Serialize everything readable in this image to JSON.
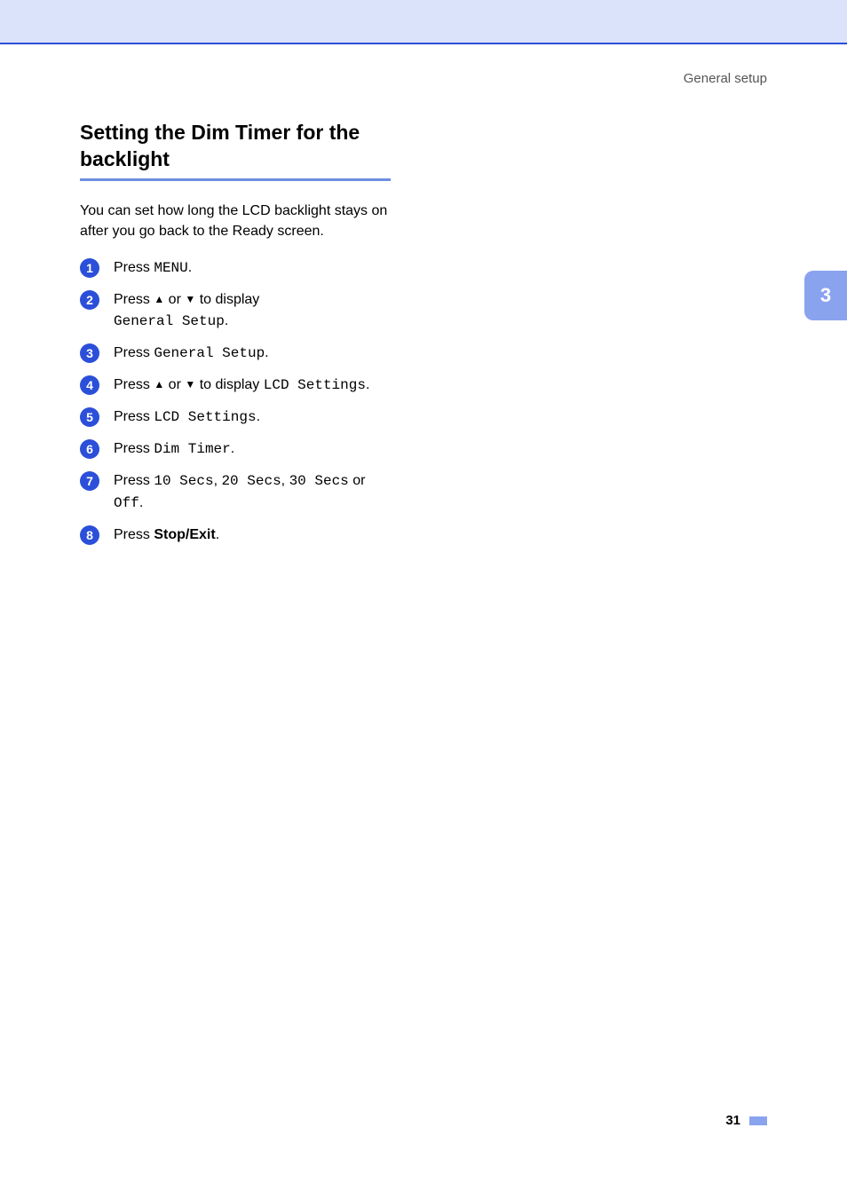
{
  "header": {
    "breadcrumb": "General setup"
  },
  "title": "Setting the Dim Timer for the backlight",
  "intro": "You can set how long the LCD backlight stays on after you go back to the Ready screen.",
  "steps": [
    {
      "num": "1",
      "prefix": "Press ",
      "mono1": "MENU",
      "mid": "",
      "mono2": "",
      "suffix": "."
    },
    {
      "num": "2",
      "prefix": "Press ",
      "up": "▲",
      "conj": " or ",
      "down": "▼",
      "mid": " to display ",
      "mono1": "General Setup",
      "suffix": ".",
      "breakBeforeMono": true
    },
    {
      "num": "3",
      "prefix": "Press ",
      "mono1": "General Setup",
      "suffix": "."
    },
    {
      "num": "4",
      "prefix": "Press ",
      "up": "▲",
      "conj": " or ",
      "down": "▼",
      "mid": " to display ",
      "mono1": "LCD Settings",
      "suffix": "."
    },
    {
      "num": "5",
      "prefix": "Press ",
      "mono1": "LCD Settings",
      "suffix": "."
    },
    {
      "num": "6",
      "prefix": "Press ",
      "mono1": "Dim Timer",
      "suffix": "."
    },
    {
      "num": "7",
      "prefix": "Press ",
      "mono1": "10 Secs",
      "sep1": ", ",
      "mono2": "20 Secs",
      "sep2": ", ",
      "mono3": "30 Secs",
      "mid": " or ",
      "mono4": "Off",
      "suffix": ".",
      "breakBeforeLast": true
    },
    {
      "num": "8",
      "prefix": "Press ",
      "bold": "Stop/Exit",
      "suffix": "."
    }
  ],
  "sideTab": "3",
  "pageNumber": "31"
}
